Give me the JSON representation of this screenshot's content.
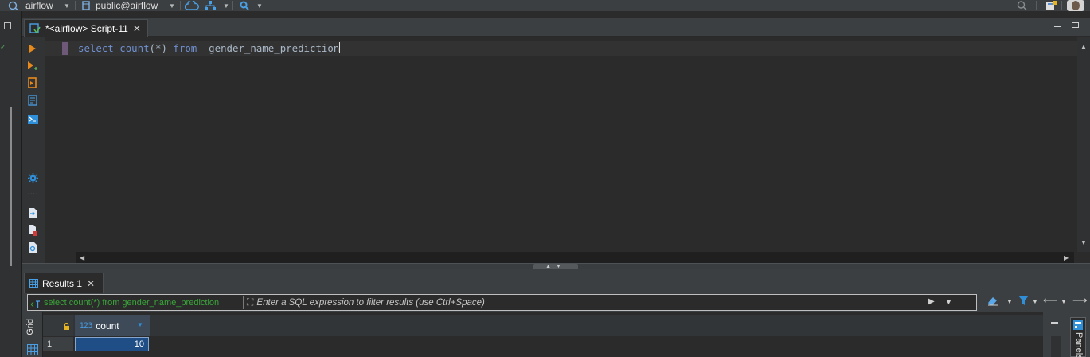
{
  "toolbar": {
    "datasource_label": "airflow",
    "schema_label": "public@airflow"
  },
  "editor": {
    "tab_title": "*<airflow> Script-11",
    "code": {
      "kw_select": "select",
      "fn_count": "count",
      "args": "(*)",
      "kw_from": "from",
      "table": "gender_name_prediction"
    }
  },
  "results": {
    "tab_title": "Results 1",
    "query_text": "select count(*) from gender_name_prediction",
    "filter_placeholder": "Enter a SQL expression to filter results (use Ctrl+Space)",
    "side_tab_label": "Grid",
    "columns": [
      "count"
    ],
    "rows": [
      {
        "row_number": "1",
        "count": "10"
      }
    ],
    "panels_label": "Panels"
  },
  "colors": {
    "accent_blue": "#2f8fd8",
    "run_orange": "#e8891b",
    "query_green": "#3aa53a",
    "selected_cell": "#1f4e86"
  }
}
